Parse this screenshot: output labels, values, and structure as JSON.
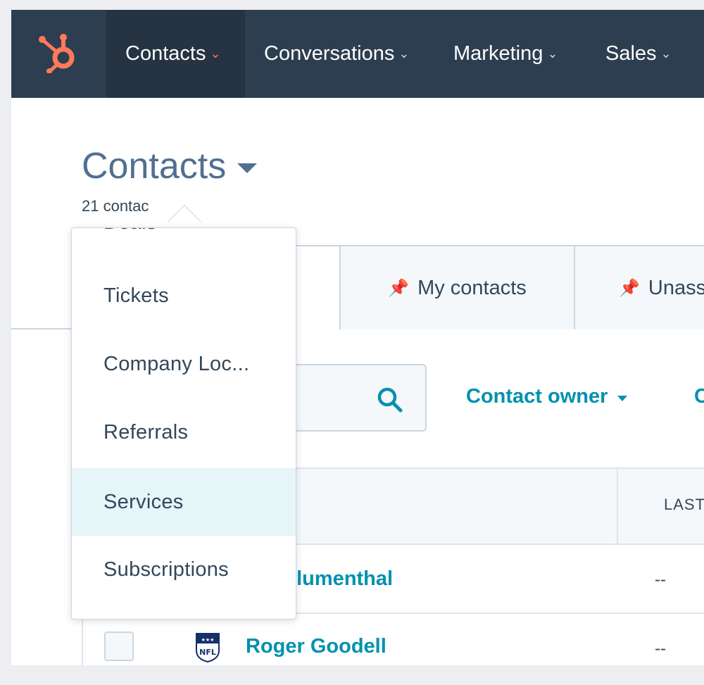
{
  "nav": {
    "items": [
      {
        "label": "Contacts",
        "active": true
      },
      {
        "label": "Conversations",
        "active": false
      },
      {
        "label": "Marketing",
        "active": false
      },
      {
        "label": "Sales",
        "active": false
      }
    ],
    "chevron": "⌄"
  },
  "page": {
    "title": "Contacts",
    "count": "21 contac"
  },
  "tabs": [
    {
      "label": "My contacts"
    },
    {
      "label": "Unass"
    }
  ],
  "filters": {
    "contact_owner": "Contact owner",
    "next_partial": "C"
  },
  "table": {
    "column_header": "LAST",
    "rows": [
      {
        "name": "e Blumenthal",
        "last": "--"
      },
      {
        "name": "Roger Goodell",
        "last": "--"
      }
    ]
  },
  "dropdown": {
    "items": [
      {
        "label": "Deals"
      },
      {
        "label": "Tickets"
      },
      {
        "label": "Company Loc..."
      },
      {
        "label": "Referrals"
      },
      {
        "label": "Services"
      },
      {
        "label": "Subscriptions"
      }
    ],
    "highlighted": "Services"
  },
  "icons": {
    "logo": "hubspot-sprocket-icon",
    "pin": "pin-icon",
    "search": "search-icon",
    "team_logo": "nfl-shield-icon"
  },
  "colors": {
    "nav_bg": "#2d3e50",
    "accent_orange": "#ff7a59",
    "link_teal": "#0091ae",
    "title_slate": "#516f90",
    "highlight": "#e5f5f8"
  }
}
